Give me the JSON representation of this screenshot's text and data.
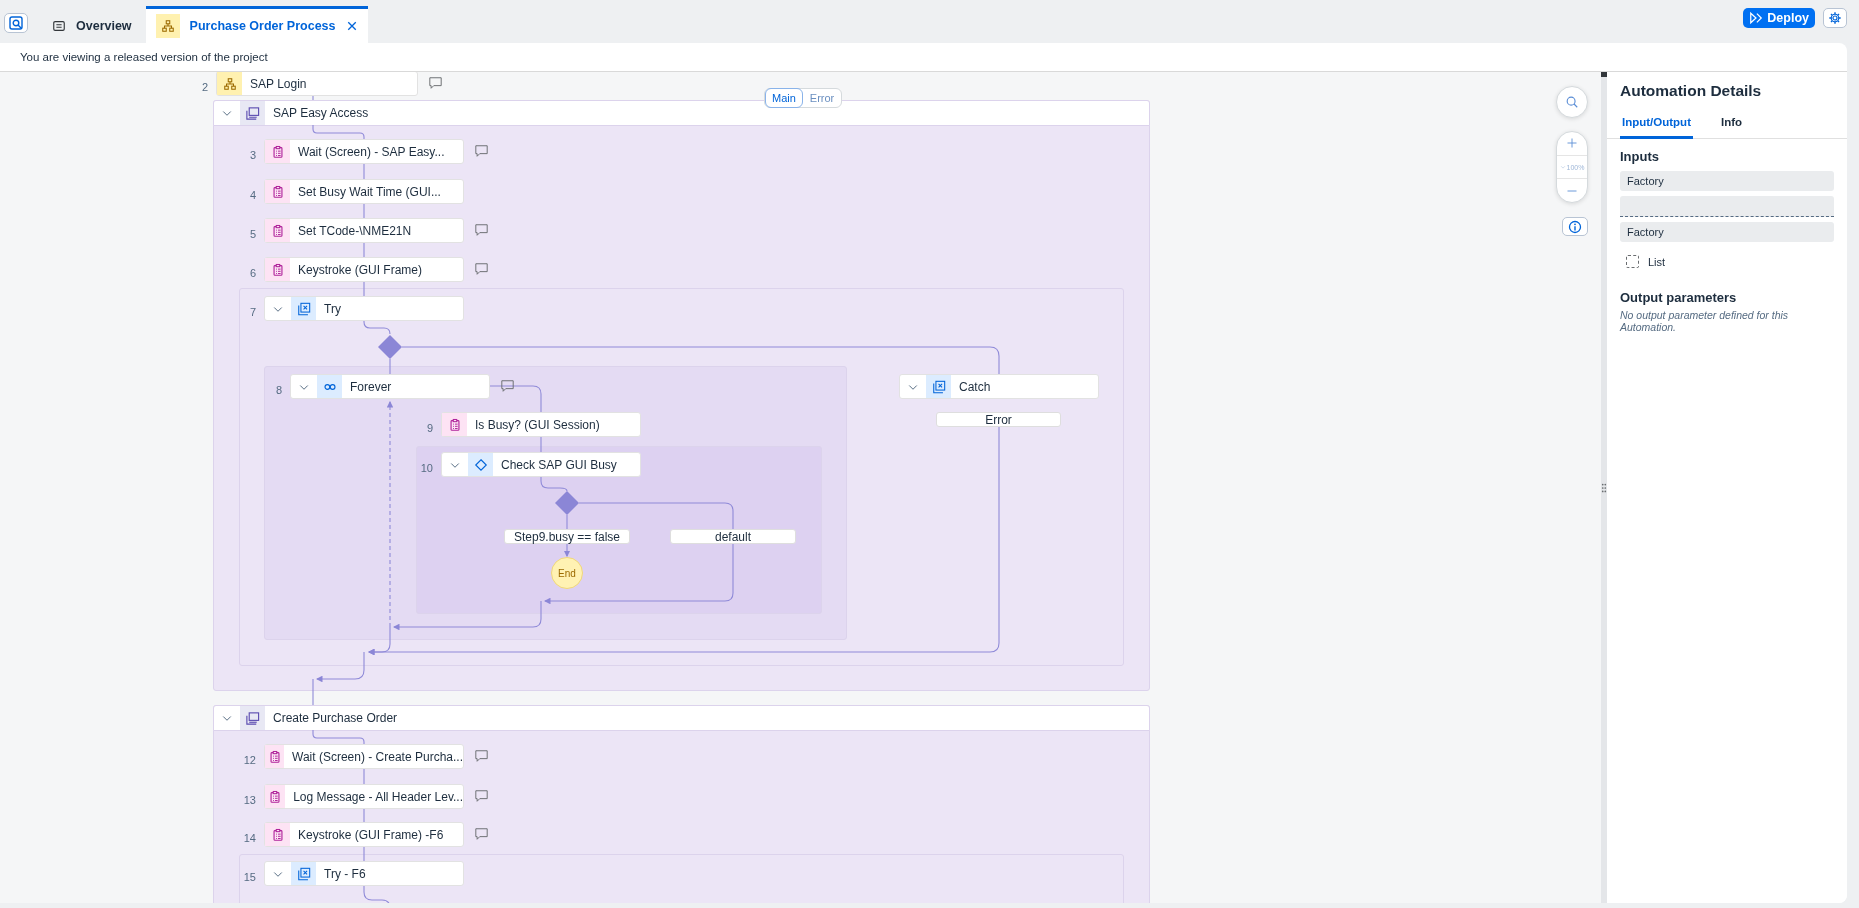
{
  "tabs": [
    {
      "label": "Overview",
      "kind": "overview",
      "selected": false
    },
    {
      "label": "Purchase Order Process",
      "kind": "process",
      "selected": true
    }
  ],
  "deploy_button": "Deploy",
  "notice": "You are viewing a released version of the project",
  "canvas": {
    "view_toggle": [
      {
        "label": "Main",
        "selected": true
      },
      {
        "label": "Error",
        "selected": false
      }
    ],
    "zoom_level": "100%",
    "flow": [
      {
        "kind": "subflow",
        "number": "2",
        "label": "SAP Login",
        "comment": true
      },
      {
        "kind": "screen",
        "label": "SAP Easy Access",
        "expanded": true,
        "children": [
          {
            "kind": "step",
            "number": "3",
            "label": "Wait (Screen) - SAP Easy...",
            "comment": true
          },
          {
            "kind": "step",
            "number": "4",
            "label": "Set Busy Wait Time (GUI...",
            "comment": false
          },
          {
            "kind": "step",
            "number": "5",
            "label": "Set TCode-\\NME21N",
            "comment": true
          },
          {
            "kind": "step",
            "number": "6",
            "label": "Keystroke (GUI Frame)",
            "comment": true
          },
          {
            "kind": "try",
            "number": "7",
            "label": "Try",
            "expanded": true,
            "comment": false,
            "children": [
              {
                "kind": "loop",
                "number": "8",
                "label": "Forever",
                "expanded": true,
                "comment": true,
                "children": [
                  {
                    "kind": "step",
                    "number": "9",
                    "label": "Is Busy? (GUI Session)",
                    "comment": false
                  },
                  {
                    "kind": "condition",
                    "number": "10",
                    "label": "Check SAP GUI Busy",
                    "expanded": true,
                    "comment": false,
                    "children": [
                      {
                        "kind": "branch",
                        "label": "Step9.busy == false"
                      },
                      {
                        "kind": "end",
                        "label": "End"
                      },
                      {
                        "kind": "branch",
                        "label": "default"
                      }
                    ]
                  }
                ]
              },
              {
                "kind": "catch",
                "label": "Catch",
                "expanded": true,
                "children": [
                  {
                    "kind": "branch",
                    "label": "Error"
                  }
                ]
              }
            ]
          }
        ]
      },
      {
        "kind": "screen",
        "label": "Create Purchase Order",
        "expanded": true,
        "children": [
          {
            "kind": "step",
            "number": "12",
            "label": "Wait (Screen) - Create Purcha...",
            "comment": true
          },
          {
            "kind": "step",
            "number": "13",
            "label": "Log Message - All Header Lev...",
            "comment": true
          },
          {
            "kind": "step",
            "number": "14",
            "label": "Keystroke (GUI Frame) -F6",
            "comment": true
          },
          {
            "kind": "try",
            "number": "15",
            "label": "Try - F6",
            "expanded": true,
            "comment": false
          }
        ]
      }
    ]
  },
  "details": {
    "title": "Automation Details",
    "tabs": [
      {
        "label": "Input/Output",
        "selected": true
      },
      {
        "label": "Info",
        "selected": false
      }
    ],
    "inputs_heading": "Inputs",
    "inputs": [
      {
        "name": "Factory",
        "type": "Factory",
        "list_label": "List",
        "list_checked": false
      }
    ],
    "outputs_heading": "Output parameters",
    "outputs_empty": "No output parameter defined for this Automation."
  }
}
